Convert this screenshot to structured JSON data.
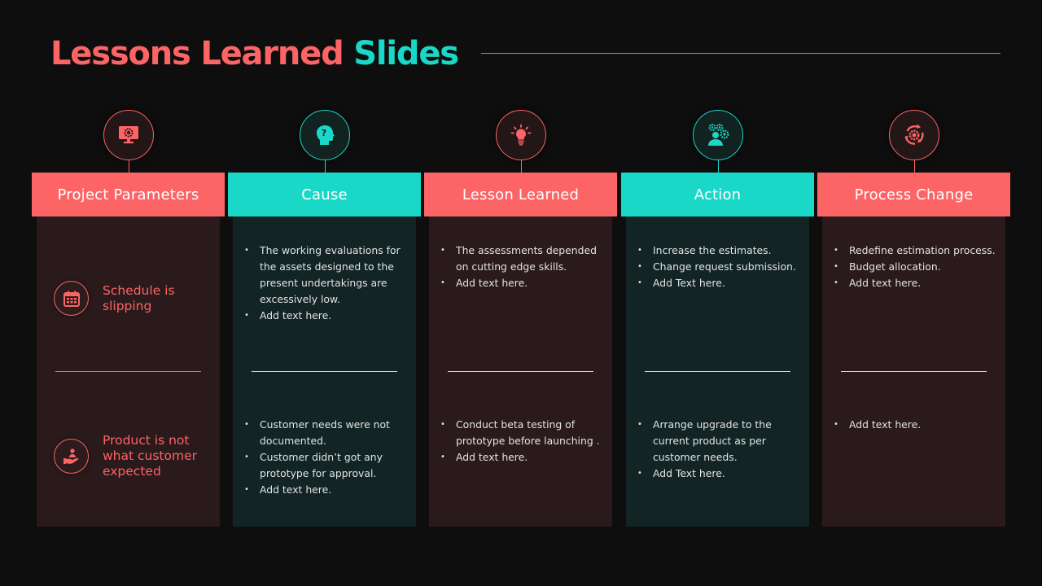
{
  "title": {
    "part1": "Lessons Learned",
    "part2": "Slides"
  },
  "colors": {
    "background": "#0e0e0e",
    "accent_red": "#fc6466",
    "accent_teal": "#1ad8c8",
    "panel_red": "#2a1a1b",
    "panel_teal": "#132424"
  },
  "columns": [
    {
      "header": "Project Parameters",
      "icon": "monitor-gear-icon",
      "theme": "red",
      "problems": [
        {
          "label": "Schedule is slipping",
          "icon": "calendar-icon"
        },
        {
          "label": "Product is not what customer expected",
          "icon": "hand-user-icon"
        }
      ]
    },
    {
      "header": "Cause",
      "icon": "head-question-icon",
      "theme": "teal",
      "top": [
        "The working evaluations for the assets designed to the present undertakings are excessively low.",
        "Add text here."
      ],
      "bottom": [
        "Customer needs were not documented.",
        "Customer didn’t got any prototype for approval.",
        "Add text here."
      ]
    },
    {
      "header": "Lesson Learned",
      "icon": "lightbulb-icon",
      "theme": "red",
      "top": [
        "The assessments depended on cutting edge skills.",
        "Add text here."
      ],
      "bottom": [
        "Conduct beta testing of prototype before launching .",
        "Add text here."
      ]
    },
    {
      "header": "Action",
      "icon": "user-gears-icon",
      "theme": "teal",
      "top": [
        "Increase the estimates.",
        "Change request submission.",
        "Add Text here."
      ],
      "bottom": [
        "Arrange upgrade to the current product as per customer needs.",
        "Add Text here."
      ]
    },
    {
      "header": "Process Change",
      "icon": "cycle-gear-icon",
      "theme": "red",
      "top": [
        "Redefine estimation process.",
        "Budget allocation.",
        "Add text here."
      ],
      "bottom": [
        "Add text here."
      ]
    }
  ]
}
